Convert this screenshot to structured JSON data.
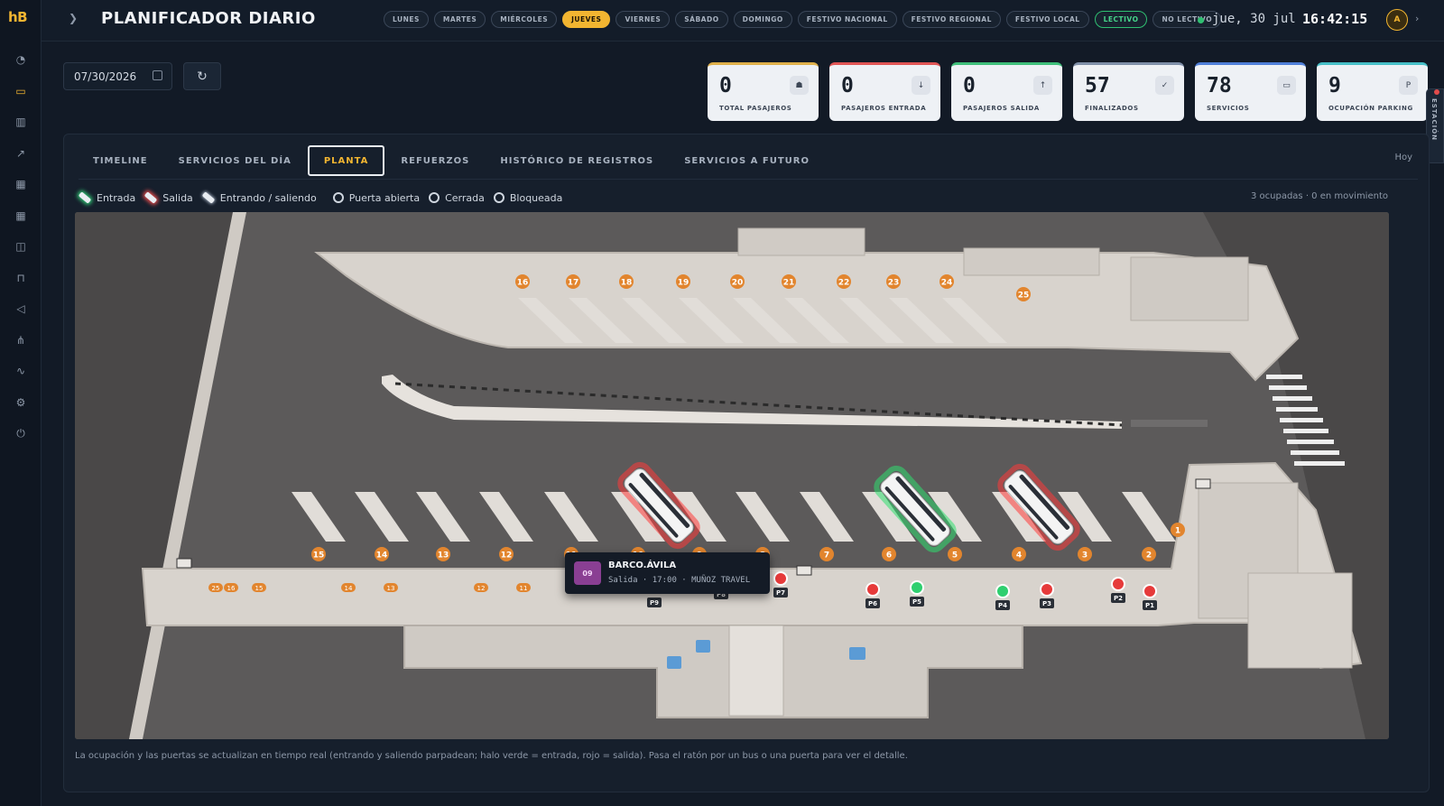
{
  "app": {
    "logo": "hB",
    "title": "PLANIFICADOR DIARIO"
  },
  "sidebar": {
    "icons": [
      "dashboard-icon",
      "monitor-icon",
      "building-icon",
      "route-icon",
      "calendar-icon",
      "calendar-alt-icon",
      "bus-icon",
      "gate-icon",
      "megaphone-icon",
      "network-icon",
      "chart-icon",
      "settings-icon",
      "plug-icon"
    ],
    "active_index": 1
  },
  "header": {
    "day_chips": [
      {
        "label": "LUNES",
        "state": "default"
      },
      {
        "label": "MARTES",
        "state": "default"
      },
      {
        "label": "MIÉRCOLES",
        "state": "default"
      },
      {
        "label": "JUEVES",
        "state": "active"
      },
      {
        "label": "VIERNES",
        "state": "default"
      },
      {
        "label": "SÁBADO",
        "state": "default"
      },
      {
        "label": "DOMINGO",
        "state": "default"
      },
      {
        "label": "FESTIVO NACIONAL",
        "state": "default"
      },
      {
        "label": "FESTIVO REGIONAL",
        "state": "default"
      },
      {
        "label": "FESTIVO LOCAL",
        "state": "default"
      },
      {
        "label": "LECTIVO",
        "state": "green"
      },
      {
        "label": "NO LECTIVO",
        "state": "default"
      }
    ],
    "date": "jue, 30 jul",
    "time": "16:42:15",
    "avatar": "A"
  },
  "controls": {
    "date_value": "07/30/2026"
  },
  "kpis": [
    {
      "value": "0",
      "label": "TOTAL PASAJEROS",
      "icon": "☗",
      "accent": "#dfb04a"
    },
    {
      "value": "0",
      "label": "PASAJEROS ENTRADA",
      "icon": "↓",
      "accent": "#e05555"
    },
    {
      "value": "0",
      "label": "PASAJEROS SALIDA",
      "icon": "↑",
      "accent": "#3fbf7a"
    },
    {
      "value": "57",
      "label": "FINALIZADOS",
      "icon": "✓",
      "accent": "#7f8fa8"
    },
    {
      "value": "78",
      "label": "SERVICIOS",
      "icon": "▭",
      "accent": "#4f7fd8"
    },
    {
      "value": "9",
      "label": "OCUPACIÓN PARKING",
      "icon": "P",
      "accent": "#46bfc7"
    }
  ],
  "side_tab": {
    "label": "ESTACIÓN"
  },
  "tabs": [
    {
      "label": "TIMELINE",
      "active": false
    },
    {
      "label": "SERVICIOS DEL DÍA",
      "active": false
    },
    {
      "label": "PLANTA",
      "active": true
    },
    {
      "label": "REFUERZOS",
      "active": false
    },
    {
      "label": "HISTÓRICO DE REGISTROS",
      "active": false
    },
    {
      "label": "SERVICIOS A FUTURO",
      "active": false
    }
  ],
  "today_label": "Hoy",
  "legend": {
    "entrada": "Entrada",
    "salida": "Salida",
    "entrando_saliendo": "Entrando / saliendo",
    "puerta_abierta": "Puerta abierta",
    "cerrada": "Cerrada",
    "bloqueada": "Bloqueada"
  },
  "occupancy_text": "3 ocupadas · 0 en movimiento",
  "map": {
    "top_bays": [
      "16",
      "17",
      "18",
      "19",
      "20",
      "21",
      "22",
      "23",
      "24",
      "25"
    ],
    "bottom_bays": [
      "15",
      "14",
      "13",
      "12",
      "11",
      "10",
      "9",
      "8",
      "7",
      "6",
      "5",
      "4",
      "3",
      "2",
      "1"
    ],
    "small_labels": [
      "25",
      "16",
      "15",
      "14",
      "13",
      "12",
      "11"
    ],
    "door_labels": [
      "P9",
      "P8",
      "P7",
      "P6",
      "P5",
      "P4",
      "P3",
      "P2",
      "P1"
    ],
    "doors": [
      {
        "label": "P7",
        "status": "red"
      },
      {
        "label": "P6",
        "status": "red"
      },
      {
        "label": "P5",
        "status": "green"
      },
      {
        "label": "P4",
        "status": "green"
      },
      {
        "label": "P3",
        "status": "red"
      },
      {
        "label": "P2",
        "status": "red"
      },
      {
        "label": "P1",
        "status": "red"
      }
    ],
    "buses": [
      {
        "bay": "9",
        "halo": "red"
      },
      {
        "bay": "5",
        "halo": "green"
      },
      {
        "bay": "3",
        "halo": "red"
      }
    ]
  },
  "tooltip": {
    "badge": "09",
    "title": "BARCO.ÁVILA",
    "subtitle": "Salida · 17:00 · MUÑOZ TRAVEL"
  },
  "footnote": "La ocupación y las puertas se actualizan en tiempo real (entrando y saliendo parpadean; halo verde = entrada, rojo = salida). Pasa el ratón por un bus o una puerta para ver el detalle."
}
